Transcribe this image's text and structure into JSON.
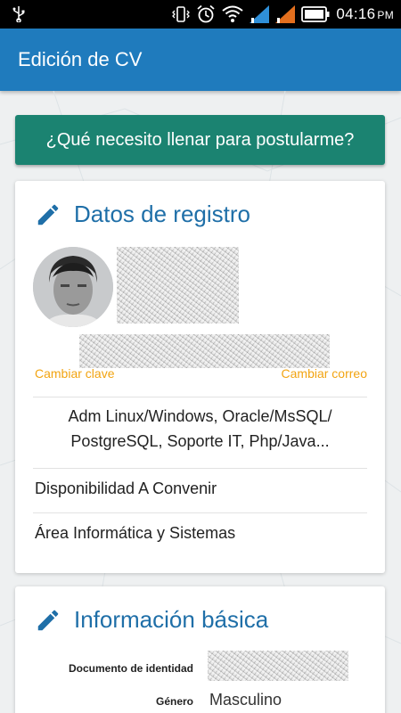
{
  "status_bar": {
    "time": "04:16",
    "ampm": "PM",
    "icons": [
      "usb-icon",
      "vibrate-icon",
      "alarm-icon",
      "wifi-icon",
      "signal-icon",
      "signal-icon",
      "battery-icon"
    ]
  },
  "app_bar": {
    "title": "Edición de CV"
  },
  "cta": {
    "label": "¿Qué necesito llenar para postularme?"
  },
  "registro": {
    "title": "Datos de registro",
    "change_password": "Cambiar clave",
    "change_email": "Cambiar correo",
    "skills": "Adm Linux/Windows, Oracle/MsSQL/ PostgreSQL, Soporte IT, Php/Java...",
    "availability": "Disponibilidad A Convenir",
    "area": "Área Informática y Sistemas"
  },
  "info_basica": {
    "title": "Información básica",
    "fields": [
      {
        "label": "Documento de identidad",
        "value": ""
      },
      {
        "label": "Género",
        "value": "Masculino"
      }
    ]
  },
  "colors": {
    "app_bar": "#1f7bbd",
    "cta": "#1b8371",
    "title_blue": "#1f6fa8",
    "link_orange": "#f2a412"
  }
}
